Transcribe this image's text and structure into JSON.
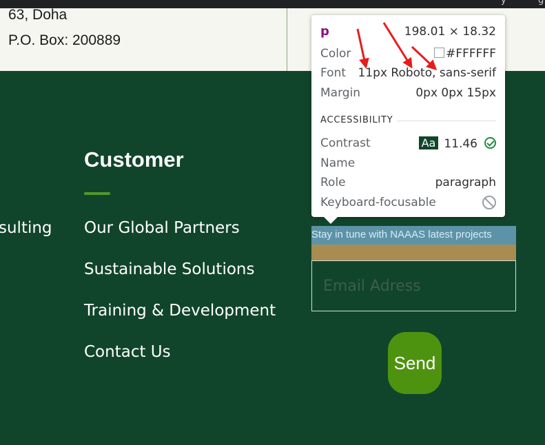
{
  "topbar": {
    "fragment_1": "y",
    "fragment_2": "g"
  },
  "address": {
    "line1": "63, Doha",
    "line2": "P.O. Box: 200889"
  },
  "footer": {
    "left_fragment": "sulting",
    "customer_heading": "Customer",
    "links": [
      {
        "label": "Our Global Partners"
      },
      {
        "label": "Sustainable Solutions"
      },
      {
        "label": "Training & Development"
      },
      {
        "label": "Contact Us"
      }
    ]
  },
  "newsletter": {
    "text": "Stay in tune with NAAAS latest projects",
    "email_placeholder": "Email Adress",
    "email_value": "",
    "send_label": "Send"
  },
  "inspector": {
    "tag": "p",
    "dimensions": "198.01 × 18.32",
    "color_label": "Color",
    "color_value": "#FFFFFF",
    "font_label": "Font",
    "font_value": "11px Roboto, sans-serif",
    "margin_label": "Margin",
    "margin_value": "0px 0px 15px",
    "accessibility_heading": "ACCESSIBILITY",
    "contrast_label": "Contrast",
    "contrast_badge": "Aa",
    "contrast_value": "11.46",
    "name_label": "Name",
    "name_value": "",
    "role_label": "Role",
    "role_value": "paragraph",
    "keyboard_label": "Keyboard-focusable"
  },
  "colors": {
    "footer_bg": "#11452b",
    "accent_green": "#4e9310",
    "annotation_arrow": "#e81c1c",
    "inspector_tag": "#881280"
  },
  "icons": {
    "contrast_pass": "check-circle-icon",
    "keyboard_focusable": "ban-icon",
    "color_swatch": "color-swatch-icon"
  }
}
